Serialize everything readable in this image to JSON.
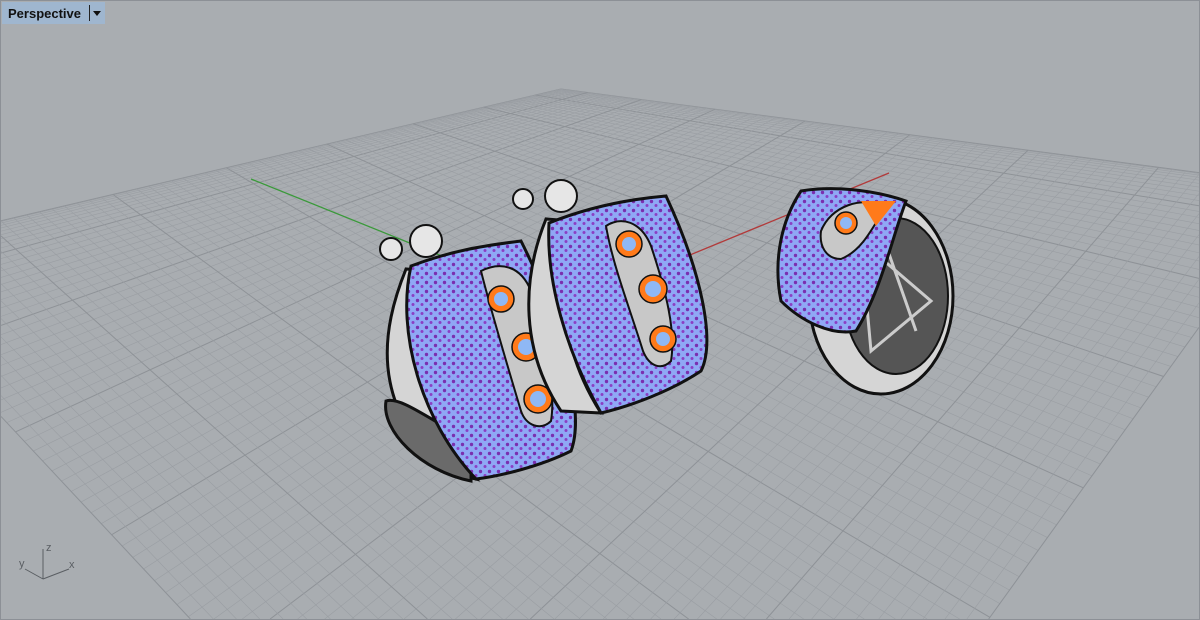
{
  "viewport": {
    "title": "Perspective",
    "menu_icon": "chevron-down-icon",
    "axis_labels": {
      "x": "x",
      "y": "y",
      "z": "z"
    }
  },
  "colors": {
    "background": "#a9adb1",
    "grid_line": "#9a9ea3",
    "x_axis": "#b23a3a",
    "y_axis": "#3a9a3a",
    "metal": "#d9d9d9",
    "pave_band": "#8fa8f5",
    "pave_dots": "#7a2fb0",
    "stones": "#ff7a1a"
  }
}
